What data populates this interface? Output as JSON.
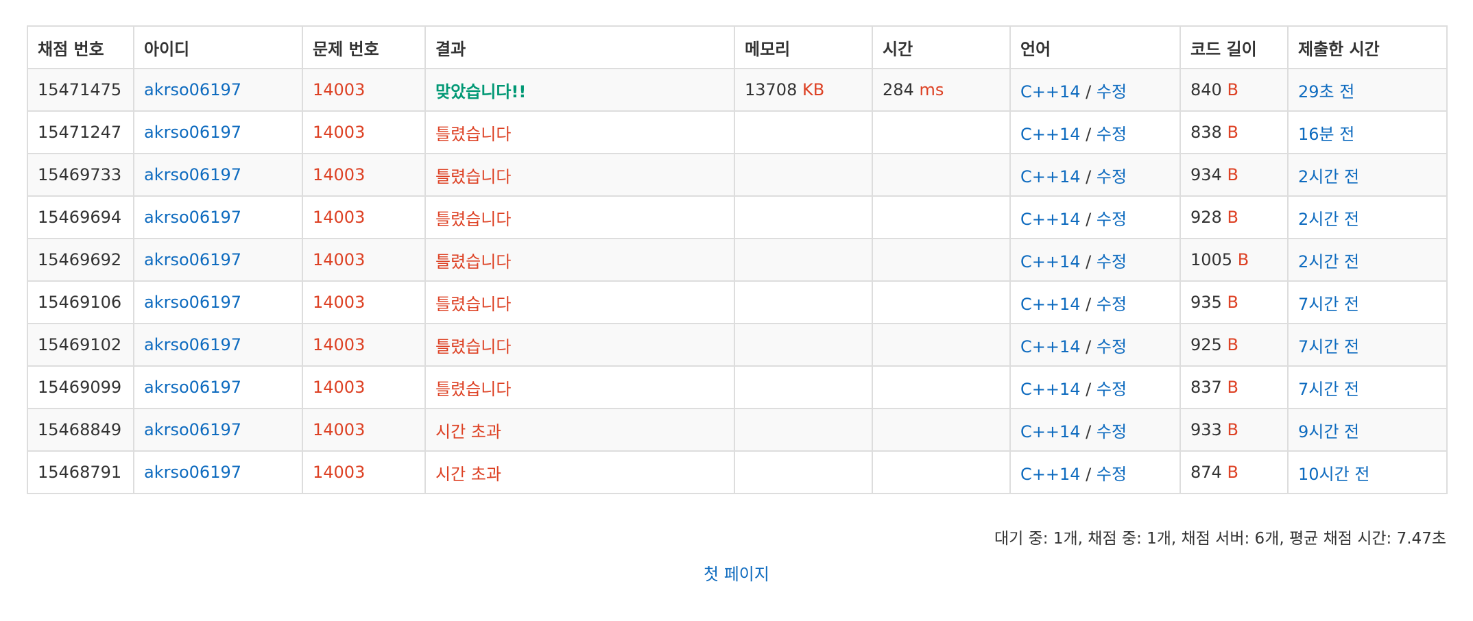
{
  "table": {
    "headers": [
      "채점 번호",
      "아이디",
      "문제 번호",
      "결과",
      "메모리",
      "시간",
      "언어",
      "코드 길이",
      "제출한 시간"
    ],
    "rows": [
      {
        "id": "15471475",
        "user": "akrso06197",
        "problem": "14003",
        "result": "맞았습니다!!",
        "result_type": "ac",
        "memory": "13708",
        "memory_unit": "KB",
        "time": "284",
        "time_unit": "ms",
        "language": "C++14",
        "edit": "수정",
        "code_length": "840",
        "code_unit": "B",
        "submitted": "29초 전"
      },
      {
        "id": "15471247",
        "user": "akrso06197",
        "problem": "14003",
        "result": "틀렸습니다",
        "result_type": "wa",
        "memory": "",
        "memory_unit": "",
        "time": "",
        "time_unit": "",
        "language": "C++14",
        "edit": "수정",
        "code_length": "838",
        "code_unit": "B",
        "submitted": "16분 전"
      },
      {
        "id": "15469733",
        "user": "akrso06197",
        "problem": "14003",
        "result": "틀렸습니다",
        "result_type": "wa",
        "memory": "",
        "memory_unit": "",
        "time": "",
        "time_unit": "",
        "language": "C++14",
        "edit": "수정",
        "code_length": "934",
        "code_unit": "B",
        "submitted": "2시간 전"
      },
      {
        "id": "15469694",
        "user": "akrso06197",
        "problem": "14003",
        "result": "틀렸습니다",
        "result_type": "wa",
        "memory": "",
        "memory_unit": "",
        "time": "",
        "time_unit": "",
        "language": "C++14",
        "edit": "수정",
        "code_length": "928",
        "code_unit": "B",
        "submitted": "2시간 전"
      },
      {
        "id": "15469692",
        "user": "akrso06197",
        "problem": "14003",
        "result": "틀렸습니다",
        "result_type": "wa",
        "memory": "",
        "memory_unit": "",
        "time": "",
        "time_unit": "",
        "language": "C++14",
        "edit": "수정",
        "code_length": "1005",
        "code_unit": "B",
        "submitted": "2시간 전"
      },
      {
        "id": "15469106",
        "user": "akrso06197",
        "problem": "14003",
        "result": "틀렸습니다",
        "result_type": "wa",
        "memory": "",
        "memory_unit": "",
        "time": "",
        "time_unit": "",
        "language": "C++14",
        "edit": "수정",
        "code_length": "935",
        "code_unit": "B",
        "submitted": "7시간 전"
      },
      {
        "id": "15469102",
        "user": "akrso06197",
        "problem": "14003",
        "result": "틀렸습니다",
        "result_type": "wa",
        "memory": "",
        "memory_unit": "",
        "time": "",
        "time_unit": "",
        "language": "C++14",
        "edit": "수정",
        "code_length": "925",
        "code_unit": "B",
        "submitted": "7시간 전"
      },
      {
        "id": "15469099",
        "user": "akrso06197",
        "problem": "14003",
        "result": "틀렸습니다",
        "result_type": "wa",
        "memory": "",
        "memory_unit": "",
        "time": "",
        "time_unit": "",
        "language": "C++14",
        "edit": "수정",
        "code_length": "837",
        "code_unit": "B",
        "submitted": "7시간 전"
      },
      {
        "id": "15468849",
        "user": "akrso06197",
        "problem": "14003",
        "result": "시간 초과",
        "result_type": "tle",
        "memory": "",
        "memory_unit": "",
        "time": "",
        "time_unit": "",
        "language": "C++14",
        "edit": "수정",
        "code_length": "933",
        "code_unit": "B",
        "submitted": "9시간 전"
      },
      {
        "id": "15468791",
        "user": "akrso06197",
        "problem": "14003",
        "result": "시간 초과",
        "result_type": "tle",
        "memory": "",
        "memory_unit": "",
        "time": "",
        "time_unit": "",
        "language": "C++14",
        "edit": "수정",
        "code_length": "874",
        "code_unit": "B",
        "submitted": "10시간 전"
      }
    ]
  },
  "footer": {
    "stats": "대기 중: 1개, 채점 중: 1개, 채점 서버: 6개, 평균 채점 시간: 7.47초"
  },
  "pagination": {
    "first_page": "첫 페이지"
  },
  "colors": {
    "link": "#0e6bbf",
    "accepted": "#009874",
    "wrong": "#dd4124",
    "border": "#dddddd",
    "stripe": "#f9f9f9"
  }
}
